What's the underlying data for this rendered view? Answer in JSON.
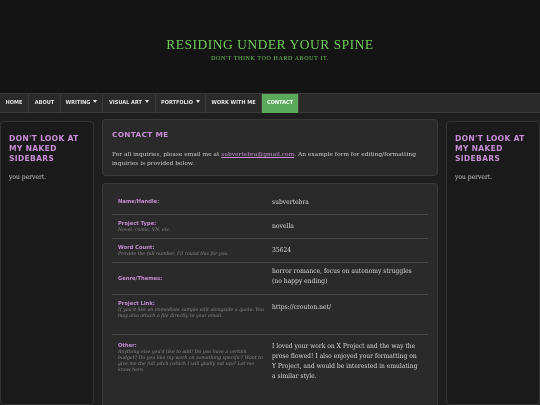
{
  "header": {
    "title": "RESIDING UNDER YOUR SPINE",
    "subtitle": "DON'T THINK TOO HARD ABOUT IT."
  },
  "nav": {
    "items": [
      {
        "label": "HOME",
        "dropdown": false,
        "active": false
      },
      {
        "label": "ABOUT",
        "dropdown": false,
        "active": false
      },
      {
        "label": "WRITING",
        "dropdown": true,
        "active": false
      },
      {
        "label": "VISUAL ART",
        "dropdown": true,
        "active": false
      },
      {
        "label": "PORTFOLIO",
        "dropdown": true,
        "active": false
      },
      {
        "label": "WORK WITH ME",
        "dropdown": false,
        "active": false
      },
      {
        "label": "CONTACT",
        "dropdown": false,
        "active": true
      }
    ]
  },
  "sidebar_left": {
    "title": "DON'T LOOK AT MY NAKED SIDEBARS",
    "text": "you pervert."
  },
  "sidebar_right": {
    "title": "DON'T LOOK AT MY NAKED SIDEBARS",
    "text": "you pervert."
  },
  "contact": {
    "title": "CONTACT ME",
    "text_before": "For all inquiries, please email me at ",
    "email": "subvertebra@gmail.com",
    "text_after": ". An example form for editing/formatting inquiries is provided below."
  },
  "form": {
    "rows": [
      {
        "label": "Name/Handle:",
        "hint": "",
        "value": "subvertebra"
      },
      {
        "label": "Project Type:",
        "hint": "Novel, comic, VN, etc.",
        "value": "novella"
      },
      {
        "label": "Word Count:",
        "hint": "Provide the full number, I'll round this for you.",
        "value": "35624"
      },
      {
        "label": "Genre/Themes:",
        "hint": "",
        "value": "horror romance, focus on autonomy struggles (no happy ending)"
      },
      {
        "label": "Project Link:",
        "hint": "If you'd like an immediate sample edit alongside a quote. You may also attach a file directly to your email.",
        "value": "https://crouton.net/"
      },
      {
        "label": "Other:",
        "hint": "Anything else you'd like to add! Do you have a certain budget? Do you like my work on something specific? Want to give me the full pitch (which I will gladly eat up)? Let me know here.",
        "value": "I loved your work on X Project and the way the prose flowed! I also enjoyed your formatting on Y Project, and would be interested in emulating a similar style."
      }
    ]
  },
  "colors": {
    "accent_green": "#6fcf5a",
    "accent_purple": "#c88dd6",
    "active_tab": "#5aa85a"
  }
}
